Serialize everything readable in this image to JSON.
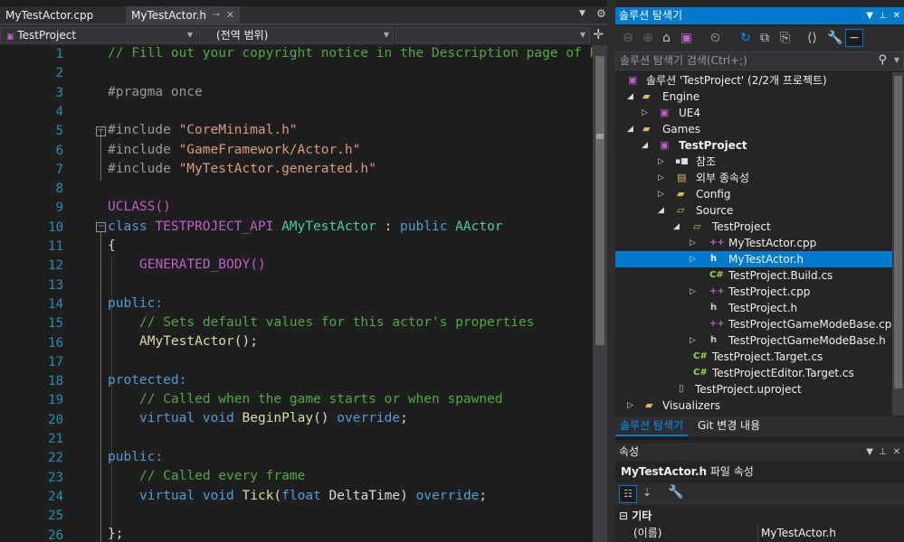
{
  "editor": {
    "tabs": [
      {
        "label": "MyTestActor.cpp"
      },
      {
        "label": "MyTestActor.h"
      }
    ],
    "nav": {
      "project": "TestProject",
      "scope": "(전역 범위)",
      "member": ""
    },
    "line_numbers": [
      "1",
      "2",
      "3",
      "4",
      "5",
      "6",
      "7",
      "8",
      "9",
      "10",
      "11",
      "12",
      "13",
      "14",
      "15",
      "16",
      "17",
      "18",
      "19",
      "20",
      "21",
      "22",
      "23",
      "24",
      "25",
      "26"
    ],
    "code": {
      "l1": "// Fill out your copyright notice in the Description page of P",
      "l3a": "#pragma",
      "l3b": " once",
      "l5a": "#include",
      "l5b": "\"CoreMinimal.h\"",
      "l6a": "#include",
      "l6b": "\"GameFramework/Actor.h\"",
      "l7a": "#include",
      "l7b": "\"MyTestActor.generated.h\"",
      "l9": "UCLASS()",
      "l10a": "class",
      "l10b": "TESTPROJECT_API",
      "l10c": "AMyTestActor",
      "l10d": " : ",
      "l10e": "public",
      "l10f": "AActor",
      "l11": "{",
      "l12": "GENERATED_BODY()",
      "l14": "public:",
      "l15": "// Sets default values for this actor's properties",
      "l16a": "AMyTestActor",
      "l16b": "();",
      "l18": "protected:",
      "l19": "// Called when the game starts or when spawned",
      "l20a": "virtual",
      "l20b": "void",
      "l20c": "BeginPlay",
      "l20d": "() ",
      "l20e": "override",
      "l20f": ";",
      "l22": "public:",
      "l23": "// Called every frame",
      "l24a": "virtual",
      "l24b": "void",
      "l24c": "Tick",
      "l24d": "(",
      "l24e": "float",
      "l24f": " DeltaTime) ",
      "l24g": "override",
      "l24h": ";",
      "l26": "};"
    }
  },
  "solution_explorer": {
    "title": "솔루션 탐색기",
    "search_placeholder": "솔루션 탐색기 검색(Ctrl+;)",
    "tree": [
      {
        "label": "솔루션 'TestProject' (2/2개 프로젝트)",
        "icon": "solution-icon"
      },
      {
        "label": "Engine",
        "icon": "folder-icon"
      },
      {
        "label": "UE4",
        "icon": "cpp-project-icon"
      },
      {
        "label": "Games",
        "icon": "folder-icon"
      },
      {
        "label": "TestProject",
        "icon": "cpp-project-icon"
      },
      {
        "label": "참조",
        "icon": "references-icon"
      },
      {
        "label": "외부 종속성",
        "icon": "external-deps-icon"
      },
      {
        "label": "Config",
        "icon": "folder-icon"
      },
      {
        "label": "Source",
        "icon": "folder-open-icon"
      },
      {
        "label": "TestProject",
        "icon": "folder-open-icon"
      },
      {
        "label": "MyTestActor.cpp",
        "icon": "cpp-file-icon"
      },
      {
        "label": "MyTestActor.h",
        "icon": "header-file-icon"
      },
      {
        "label": "TestProject.Build.cs",
        "icon": "csharp-file-icon"
      },
      {
        "label": "TestProject.cpp",
        "icon": "cpp-file-icon"
      },
      {
        "label": "TestProject.h",
        "icon": "header-file-icon"
      },
      {
        "label": "TestProjectGameModeBase.cpp",
        "icon": "cpp-file-icon"
      },
      {
        "label": "TestProjectGameModeBase.h",
        "icon": "header-file-icon"
      },
      {
        "label": "TestProject.Target.cs",
        "icon": "csharp-file-icon"
      },
      {
        "label": "TestProjectEditor.Target.cs",
        "icon": "csharp-file-icon"
      },
      {
        "label": "TestProject.uproject",
        "icon": "file-icon"
      },
      {
        "label": "Visualizers",
        "icon": "folder-icon"
      }
    ],
    "bottom_tabs": [
      "솔루션 탐색기",
      "Git 변경 내용"
    ]
  },
  "properties": {
    "title": "속성",
    "subject": "MyTestActor.h",
    "subject_suffix": " 파일 속성",
    "category": "기타",
    "rows": [
      {
        "key": "(이름)",
        "value": "MyTestActor.h"
      }
    ]
  },
  "colors": {
    "accent": "#007acc",
    "comment": "#57a64a",
    "keyword": "#569cd6",
    "string": "#d69d85",
    "type": "#4ec9b0",
    "line_number": "#2b91af"
  }
}
